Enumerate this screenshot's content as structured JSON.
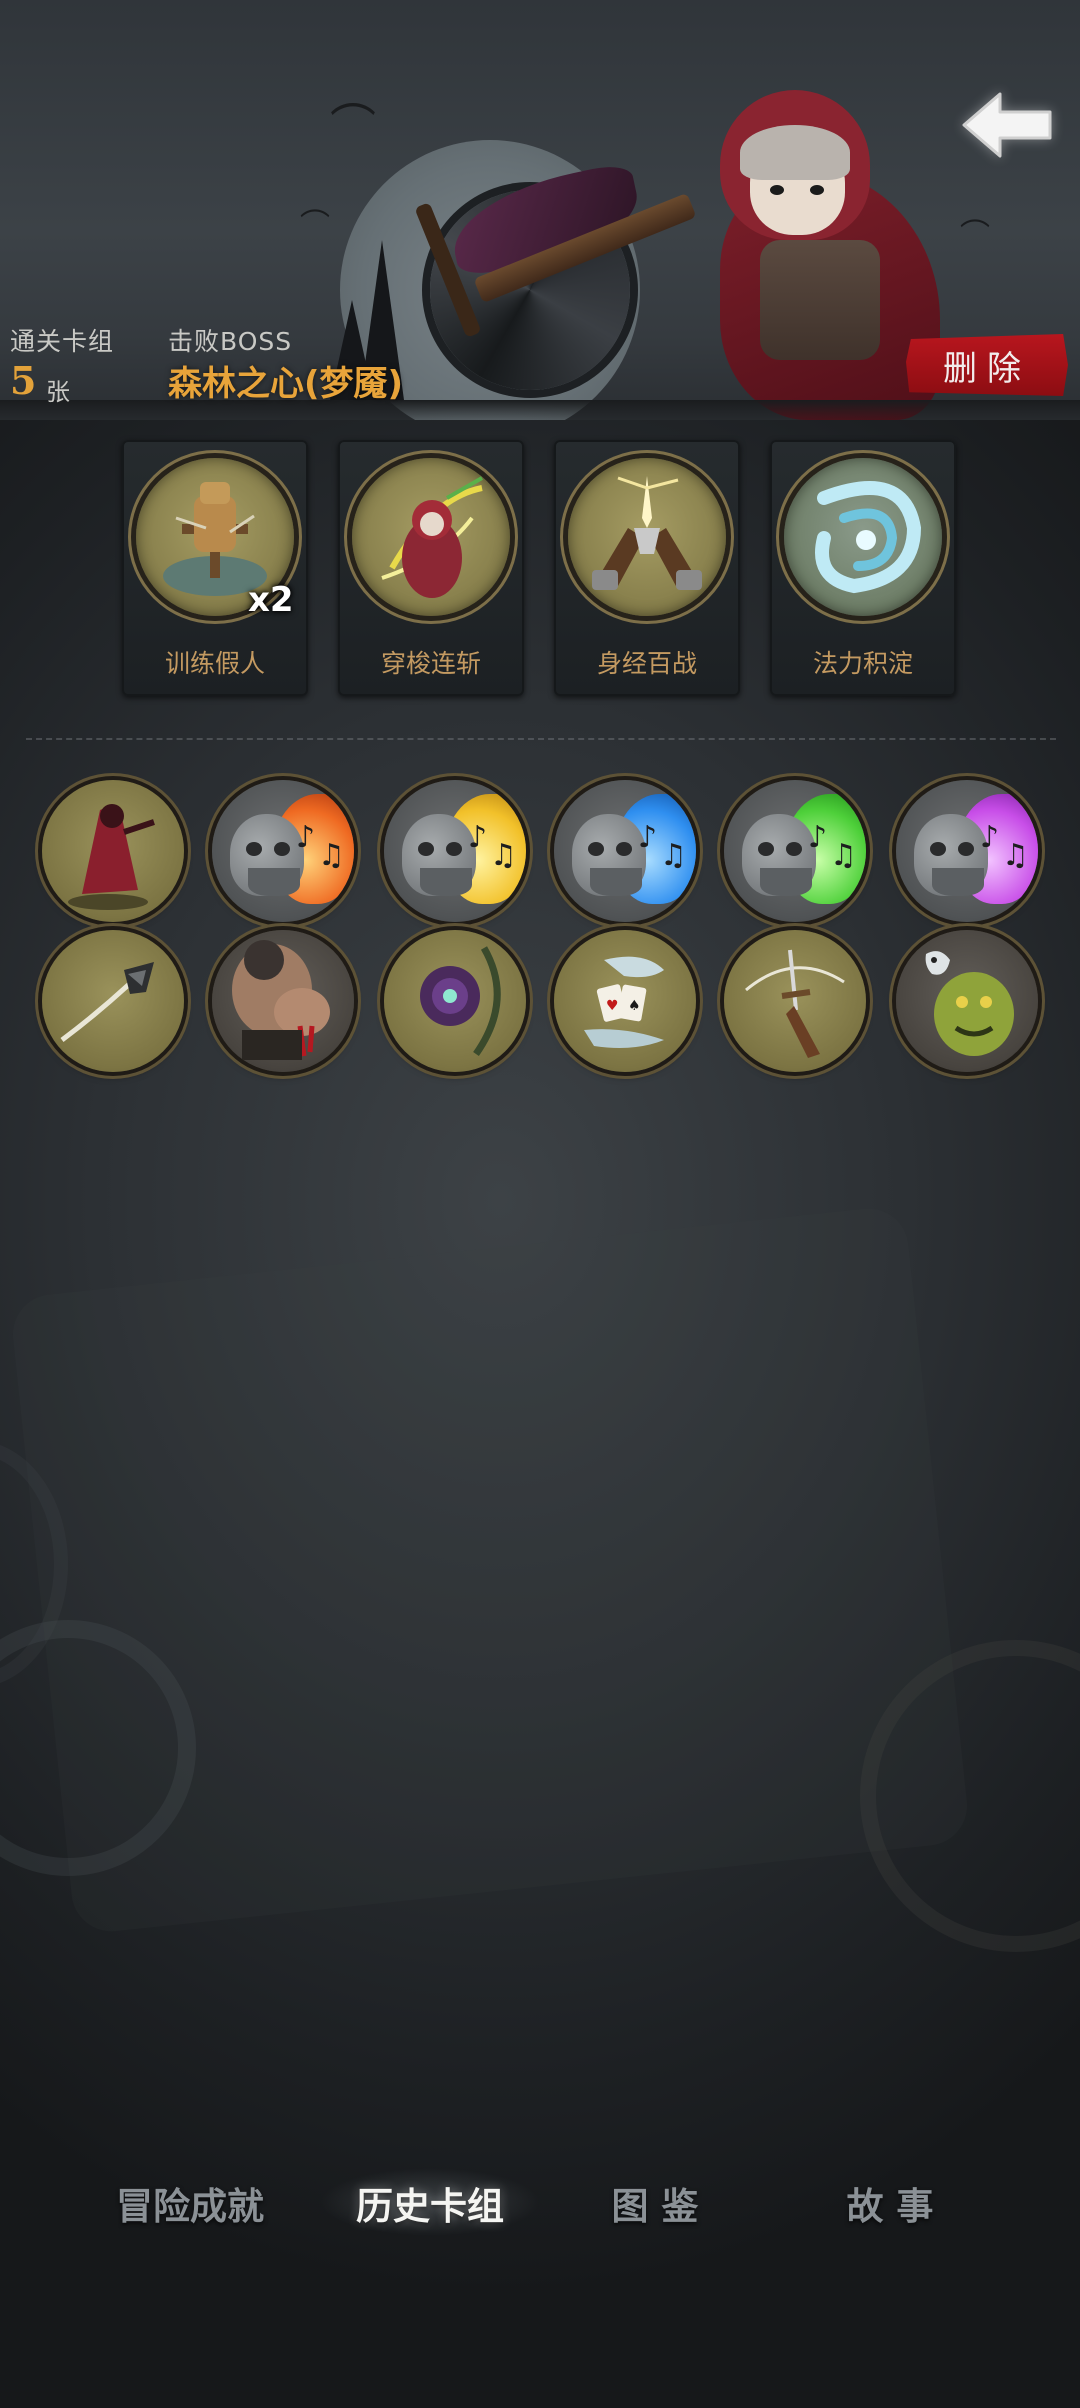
{
  "header": {
    "cleared_deck_label": "通关卡组",
    "cleared_deck_count": "5",
    "cleared_deck_unit": "张",
    "defeated_boss_label": "击败BOSS",
    "defeated_boss_name": "森林之心(梦魇)",
    "delete_label": "删除",
    "back_icon": "back-arrow-icon"
  },
  "deck_cards": [
    {
      "name": "训练假人",
      "icon": "training-dummy-icon",
      "multiplier": "x2"
    },
    {
      "name": "穿梭连斩",
      "icon": "shuttle-slash-icon",
      "multiplier": ""
    },
    {
      "name": "身经百战",
      "icon": "battle-hardened-icon",
      "multiplier": ""
    },
    {
      "name": "法力积淀",
      "icon": "mana-accumulation-icon",
      "multiplier": ""
    }
  ],
  "items": [
    {
      "icon": "red-hood-silhouette-icon"
    },
    {
      "icon": "music-skull-orange-icon",
      "color": "#ef6a22"
    },
    {
      "icon": "music-skull-yellow-icon",
      "color": "#f2c12a"
    },
    {
      "icon": "music-skull-blue-icon",
      "color": "#2f8ff0"
    },
    {
      "icon": "music-skull-green-icon",
      "color": "#4ed03a"
    },
    {
      "icon": "music-skull-purple-icon",
      "color": "#c84ee8"
    },
    {
      "icon": "throwing-knife-icon"
    },
    {
      "icon": "brute-fist-icon"
    },
    {
      "icon": "purple-orb-staff-icon"
    },
    {
      "icon": "ghost-hand-cards-icon"
    },
    {
      "icon": "dagger-hand-icon"
    },
    {
      "icon": "green-ogre-ghost-icon"
    }
  ],
  "tabs": [
    {
      "label": "冒险成就",
      "active": false
    },
    {
      "label": "历史卡组",
      "active": true
    },
    {
      "label": "图 鉴",
      "active": false
    },
    {
      "label": "故 事",
      "active": false
    }
  ],
  "colors": {
    "accent_gold": "#e3a23a",
    "delete_red": "#b8161e",
    "card_label": "#c49a61"
  }
}
